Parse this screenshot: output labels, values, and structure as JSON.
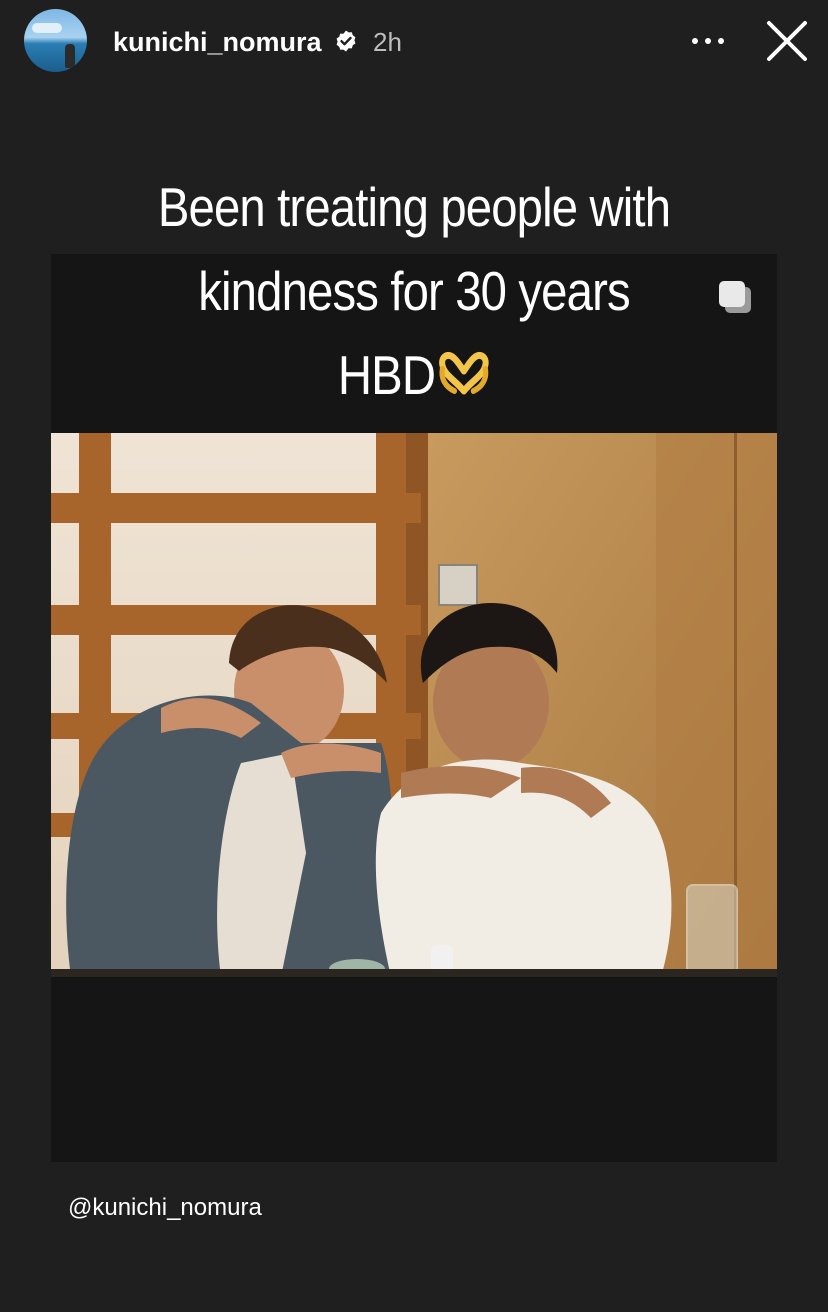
{
  "story": {
    "username": "kunichi_nomura",
    "time_ago": "2h",
    "verified": true,
    "caption_lines": [
      "Been treating people with",
      "kindness for 30 years",
      "HBD"
    ],
    "caption_emoji": "heart-hands",
    "mention": "@kunichi_nomura"
  },
  "icons": {
    "more": "more-horizontal-icon",
    "close": "close-icon",
    "verified": "verified-badge-icon",
    "multi_post": "multiple-posts-icon"
  },
  "colors": {
    "background": "#1f1f1f",
    "post_background": "#151515",
    "text": "#ffffff",
    "muted_text": "#bdbdbd"
  }
}
